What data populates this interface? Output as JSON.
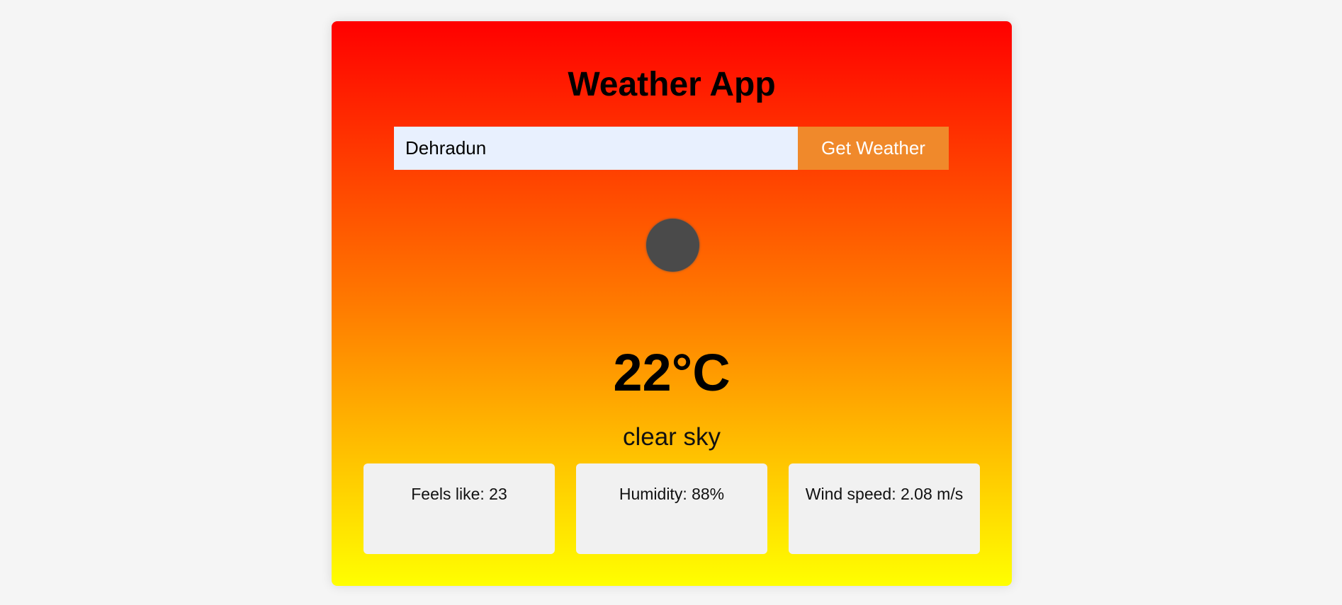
{
  "app": {
    "title": "Weather App"
  },
  "search": {
    "value": "Dehradun",
    "placeholder": "",
    "button_label": "Get Weather"
  },
  "weather": {
    "icon": "weather-status-icon",
    "temperature": "22°C",
    "description": "clear sky"
  },
  "details": [
    {
      "label": "Feels like: 23"
    },
    {
      "label": "Humidity: 88%"
    },
    {
      "label": "Wind speed: 2.08 m/s"
    }
  ],
  "colors": {
    "gradient_top": "#ff0000",
    "gradient_mid": "#ff7a00",
    "gradient_bottom": "#ffff00",
    "button": "#f0892b",
    "input_bg": "#e8f0fe",
    "tile_bg": "#f1f1f1"
  }
}
